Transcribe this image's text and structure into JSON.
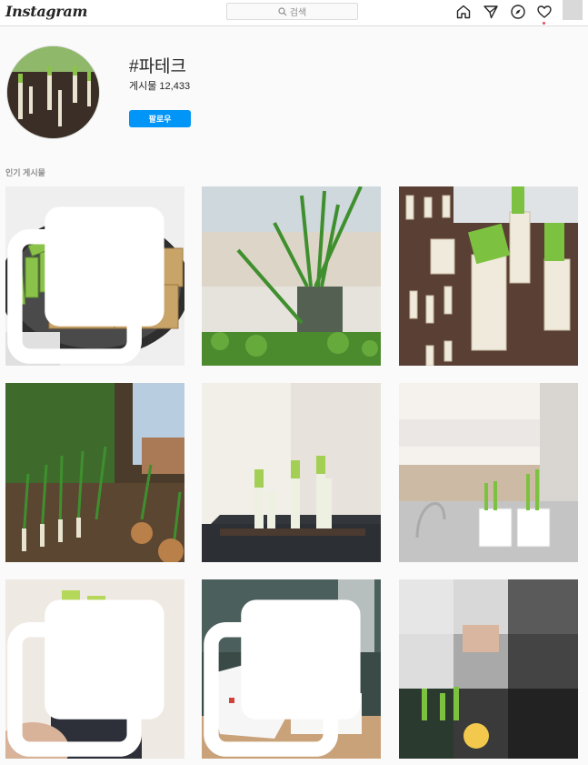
{
  "app": {
    "logo_text": "Instagram"
  },
  "search": {
    "placeholder": "검색",
    "icon": "search-icon"
  },
  "nav": {
    "icons": [
      "home-icon",
      "direct-message-icon",
      "explore-compass-icon",
      "activity-heart-icon"
    ]
  },
  "tag": {
    "name": "#파테크",
    "posts_label": "게시물 12,433",
    "follow_label": "팔로우"
  },
  "section": {
    "title": "인기 게시물"
  },
  "posts": [
    {
      "subject": "pan-fried tofu with green onion",
      "multi": true
    },
    {
      "subject": "green onion in glass jar by window",
      "multi": false
    },
    {
      "subject": "green onion stalks in soil tray",
      "multi": false
    },
    {
      "subject": "green onion garden bed",
      "multi": false
    },
    {
      "subject": "green onion in black planter",
      "multi": false
    },
    {
      "subject": "green onion in white pots on kitchen sink",
      "multi": false
    },
    {
      "subject": "green onion in dark square pot",
      "multi": true
    },
    {
      "subject": "green onion pot with towel",
      "multi": true
    },
    {
      "subject": "blurred person with green onion",
      "multi": false
    }
  ],
  "colors": {
    "accent": "#0095f6",
    "notification": "#ed4956",
    "onion_green": "#6fb43f"
  }
}
